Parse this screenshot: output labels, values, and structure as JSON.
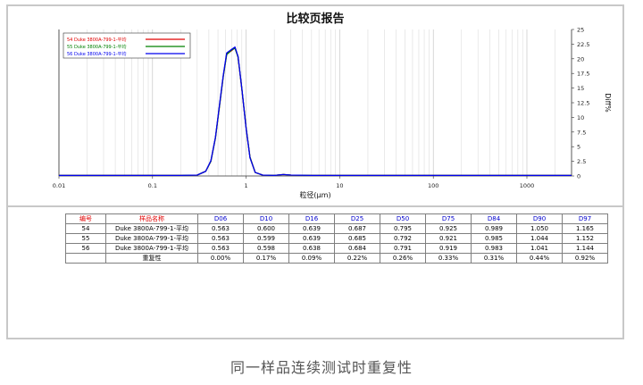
{
  "caption": "同一样品连续测试时重复性",
  "chart_data": {
    "type": "line",
    "title": "比较页报告",
    "xlabel": "粒径(µm)",
    "ylabel": "Diff%",
    "xscale": "log",
    "xlim": [
      0.01,
      3000
    ],
    "ylim": [
      0,
      25
    ],
    "x_ticks": [
      "0.01",
      "0.1",
      "1",
      "10",
      "100",
      "1000"
    ],
    "y_ticks": [
      "0",
      "2.5",
      "5",
      "7.5",
      "10",
      "12.5",
      "15",
      "17.5",
      "20",
      "22.5",
      "25"
    ],
    "grid": true,
    "legend_position": "top-left",
    "series": [
      {
        "name": "54  Duke 3800A-799-1-平均",
        "color": "#e00000",
        "points": [
          [
            0.01,
            0.1
          ],
          [
            0.2,
            0.1
          ],
          [
            0.3,
            0.15
          ],
          [
            0.37,
            0.8
          ],
          [
            0.42,
            2.5
          ],
          [
            0.47,
            6.5
          ],
          [
            0.52,
            12
          ],
          [
            0.57,
            17
          ],
          [
            0.62,
            20.8
          ],
          [
            0.7,
            21.4
          ],
          [
            0.76,
            21.9
          ],
          [
            0.82,
            20.3
          ],
          [
            0.9,
            14.8
          ],
          [
            1.0,
            8.2
          ],
          [
            1.1,
            3.2
          ],
          [
            1.25,
            0.6
          ],
          [
            1.5,
            0.15
          ],
          [
            2.0,
            0.1
          ],
          [
            2.5,
            0.25
          ],
          [
            3.0,
            0.15
          ],
          [
            5,
            0.1
          ],
          [
            3000,
            0.1
          ]
        ]
      },
      {
        "name": "55  Duke 3800A-799-1-平均",
        "color": "#008000",
        "points": [
          [
            0.01,
            0.1
          ],
          [
            0.2,
            0.1
          ],
          [
            0.3,
            0.15
          ],
          [
            0.37,
            0.8
          ],
          [
            0.42,
            2.5
          ],
          [
            0.47,
            6.5
          ],
          [
            0.52,
            12
          ],
          [
            0.57,
            17
          ],
          [
            0.62,
            20.7
          ],
          [
            0.7,
            21.5
          ],
          [
            0.76,
            21.8
          ],
          [
            0.82,
            20.3
          ],
          [
            0.9,
            14.9
          ],
          [
            1.0,
            8.2
          ],
          [
            1.1,
            3.2
          ],
          [
            1.25,
            0.6
          ],
          [
            1.5,
            0.15
          ],
          [
            2.0,
            0.1
          ],
          [
            2.5,
            0.25
          ],
          [
            3.0,
            0.15
          ],
          [
            5,
            0.1
          ],
          [
            3000,
            0.1
          ]
        ]
      },
      {
        "name": "56  Duke 3800A-799-1-平均",
        "color": "#0000ee",
        "points": [
          [
            0.01,
            0.1
          ],
          [
            0.2,
            0.1
          ],
          [
            0.3,
            0.15
          ],
          [
            0.37,
            0.8
          ],
          [
            0.42,
            2.6
          ],
          [
            0.47,
            6.6
          ],
          [
            0.52,
            12.2
          ],
          [
            0.57,
            17.2
          ],
          [
            0.62,
            21
          ],
          [
            0.7,
            21.6
          ],
          [
            0.76,
            22
          ],
          [
            0.82,
            20.4
          ],
          [
            0.9,
            14.9
          ],
          [
            1.0,
            8.1
          ],
          [
            1.1,
            3.1
          ],
          [
            1.25,
            0.6
          ],
          [
            1.5,
            0.15
          ],
          [
            2.0,
            0.1
          ],
          [
            2.5,
            0.25
          ],
          [
            3.0,
            0.15
          ],
          [
            5,
            0.1
          ],
          [
            3000,
            0.1
          ]
        ]
      }
    ]
  },
  "table": {
    "headers": [
      "编号",
      "样品名称",
      "D06",
      "D10",
      "D16",
      "D25",
      "D50",
      "D75",
      "D84",
      "D90",
      "D97"
    ],
    "rows": [
      [
        "54",
        "Duke 3800A-799-1-平均",
        "0.563",
        "0.600",
        "0.639",
        "0.687",
        "0.795",
        "0.925",
        "0.989",
        "1.050",
        "1.165"
      ],
      [
        "55",
        "Duke 3800A-799-1-平均",
        "0.563",
        "0.599",
        "0.639",
        "0.685",
        "0.792",
        "0.921",
        "0.985",
        "1.044",
        "1.152"
      ],
      [
        "56",
        "Duke 3800A-799-1-平均",
        "0.563",
        "0.598",
        "0.638",
        "0.684",
        "0.791",
        "0.919",
        "0.983",
        "1.041",
        "1.144"
      ],
      [
        "",
        "重复性",
        "0.00%",
        "0.17%",
        "0.09%",
        "0.22%",
        "0.26%",
        "0.33%",
        "0.31%",
        "0.44%",
        "0.92%"
      ]
    ]
  }
}
